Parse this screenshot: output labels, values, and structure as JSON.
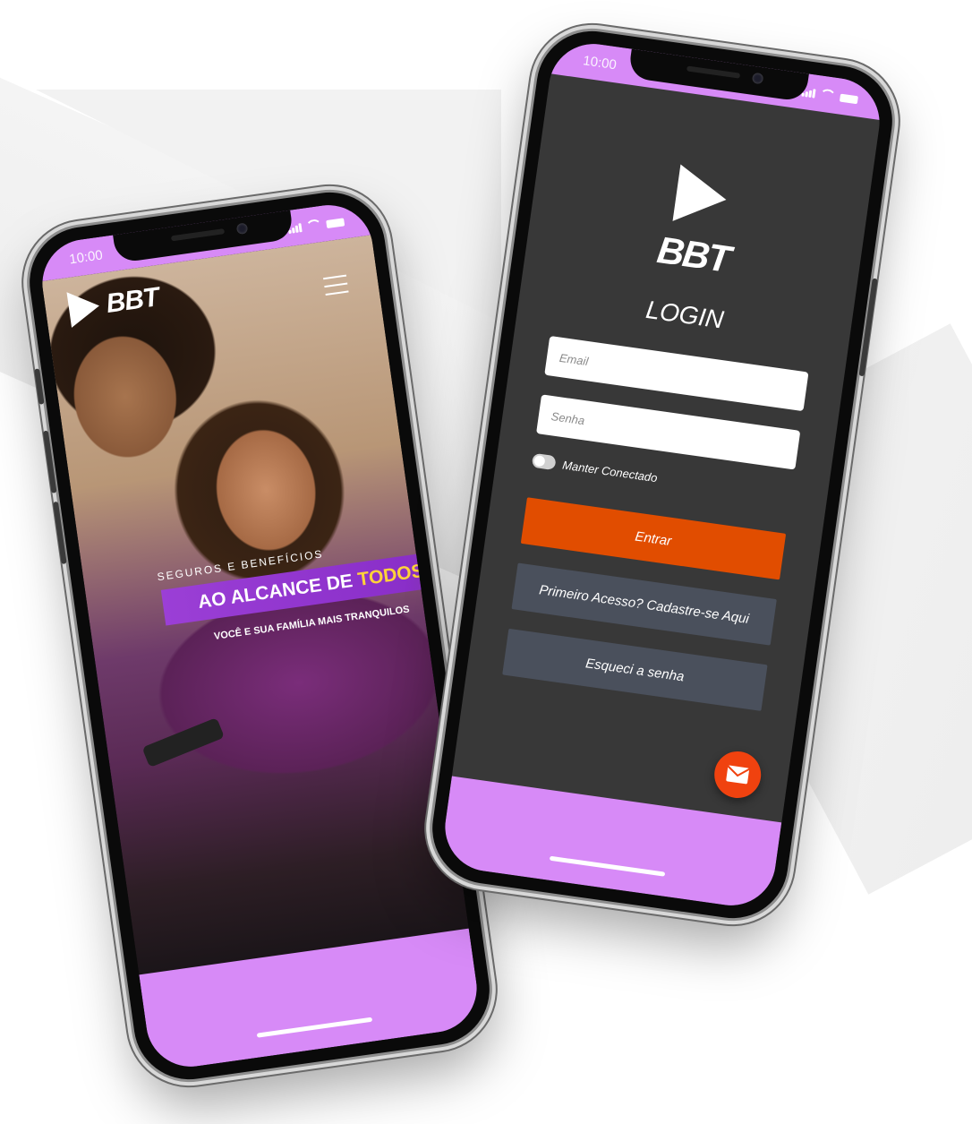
{
  "left_phone": {
    "status": {
      "time": "10:00"
    },
    "brand": "BBT",
    "menu_icon": "hamburger-menu-icon",
    "hero": {
      "kicker": "SEGUROS E BENEFÍCIOS",
      "headline_main": "AO ALCANCE DE",
      "headline_highlight": "TODOS!",
      "subline": "VOCÊ E SUA FAMÍLIA MAIS TRANQUILOS"
    }
  },
  "right_phone": {
    "status": {
      "time": "10:00"
    },
    "brand": "BBT",
    "title": "LOGIN",
    "email": {
      "placeholder": "Email",
      "value": ""
    },
    "password": {
      "placeholder": "Senha",
      "value": ""
    },
    "keep_connected": {
      "label": "Manter Conectado",
      "checked": false
    },
    "buttons": {
      "login": "Entrar",
      "signup": "Primeiro Acesso? Cadastre-se Aqui",
      "forgot": "Esqueci a senha"
    },
    "fab_icon": "mail-icon"
  },
  "colors": {
    "accent_purple": "#d78af7",
    "banner_purple": "#8a2fc9",
    "highlight_yellow": "#ffd23a",
    "primary_orange": "#e14d00",
    "secondary_button": "#4a505c",
    "login_bg": "#383838"
  }
}
